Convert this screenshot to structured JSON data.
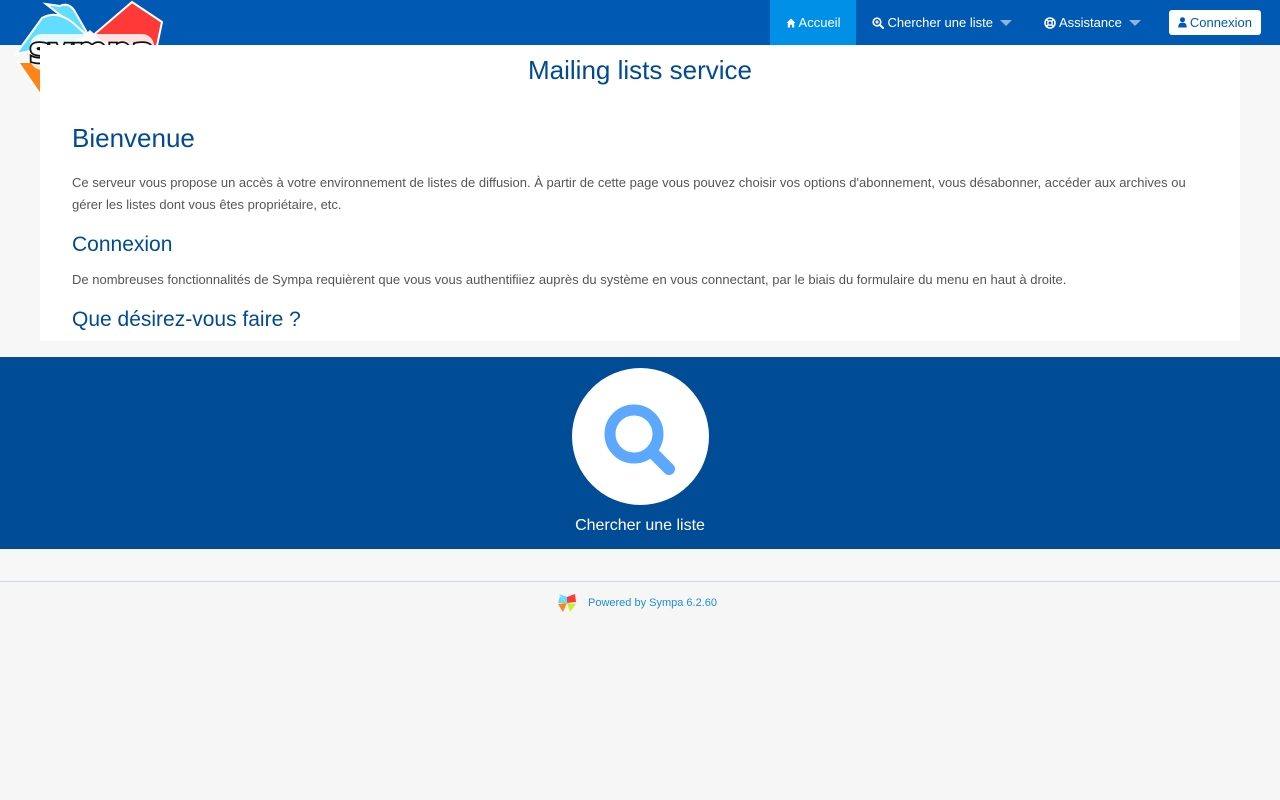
{
  "colors": {
    "navbar": "#005ab4",
    "nav_active": "#0090e8",
    "heading": "#004a94",
    "band": "#004c97",
    "search_icon": "#5ca8ff",
    "footer_link": "#1a8fd8"
  },
  "logo": {
    "text": "sympa",
    "icon": "sympa-star-logo"
  },
  "nav": {
    "home": {
      "label": "Accueil",
      "icon": "home-icon"
    },
    "search_list": {
      "label": "Chercher une liste",
      "icon": "search-plus-icon"
    },
    "help": {
      "label": "Assistance",
      "icon": "life-ring-icon"
    },
    "login": {
      "label": "Connexion",
      "icon": "user-icon"
    }
  },
  "main": {
    "title": "Mailing lists service",
    "welcome_heading": "Bienvenue",
    "welcome_text": "Ce serveur vous propose un accès à votre environnement de listes de diffusion. À partir de cette page vous pouvez choisir vos options d'abonnement, vous désabonner, accéder aux archives ou gérer les listes dont vous êtes propriétaire, etc.",
    "login_heading": "Connexion",
    "login_text": "De nombreuses fonctionnalités de Sympa requièrent que vous vous authentifiiez auprès du système en vous connectant, par le biais du formulaire du menu en haut à droite.",
    "actions_heading": "Que désirez-vous faire ?"
  },
  "actions": {
    "search_list": {
      "label": "Chercher une liste",
      "icon": "search-icon"
    }
  },
  "footer": {
    "powered_by": "Powered by Sympa 6.2.60",
    "icon": "sympa-mini-logo"
  }
}
